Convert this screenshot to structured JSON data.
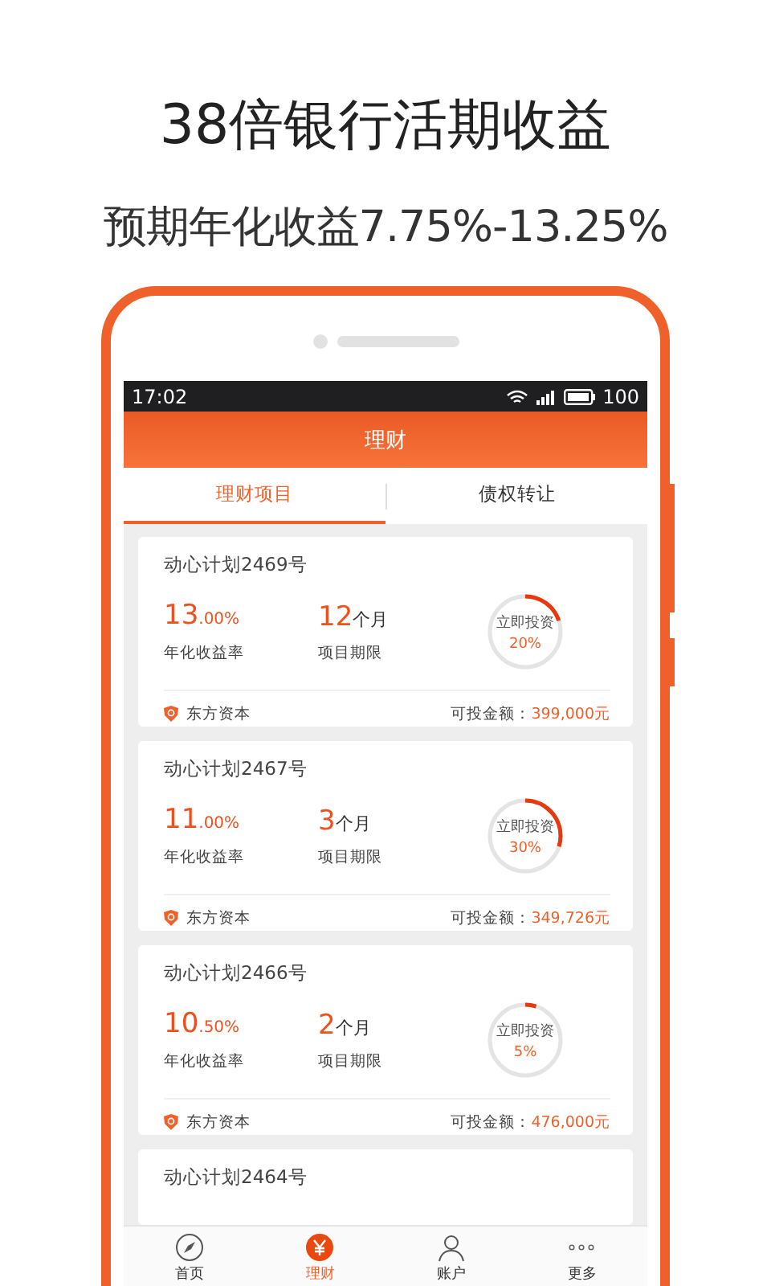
{
  "headline": "38倍银行活期收益",
  "subheadline": "预期年化收益7.75%-13.25%",
  "status_bar": {
    "time": "17:02",
    "battery": "100"
  },
  "header": {
    "title": "理财"
  },
  "tabs": [
    {
      "label": "理财项目",
      "selected": true
    },
    {
      "label": "债权转让",
      "selected": false
    }
  ],
  "products": [
    {
      "name": "动心计划2469号",
      "rate_int": "13",
      "rate_dec": ".00%",
      "rate_label": "年化收益率",
      "term": "12",
      "term_unit": "个月",
      "term_label": "项目期限",
      "action": "立即投资",
      "level": 0.2,
      "progress": "20%",
      "issuer": "东方资本",
      "available_label": "可投金额：",
      "available": "399,000元"
    },
    {
      "name": "动心计划2467号",
      "rate_int": "11",
      "rate_dec": ".00%",
      "rate_label": "年化收益率",
      "term": "3",
      "term_unit": "个月",
      "term_label": "项目期限",
      "action": "立即投资",
      "level": 0.3,
      "progress": "30%",
      "issuer": "东方资本",
      "available_label": "可投金额：",
      "available": "349,726元"
    },
    {
      "name": "动心计划2466号",
      "rate_int": "10",
      "rate_dec": ".50%",
      "rate_label": "年化收益率",
      "term": "2",
      "term_unit": "个月",
      "term_label": "项目期限",
      "action": "立即投资",
      "level": 0.05,
      "progress": "5%",
      "issuer": "东方资本",
      "available_label": "可投金额：",
      "available": "476,000元"
    },
    {
      "name": "动心计划2464号"
    }
  ],
  "nav": [
    {
      "label": "首页",
      "kind": "compass",
      "selected": false
    },
    {
      "label": "理财",
      "kind": "yen",
      "selected": true
    },
    {
      "label": "账户",
      "kind": "person",
      "selected": false
    },
    {
      "label": "更多",
      "kind": "more",
      "selected": false
    }
  ]
}
